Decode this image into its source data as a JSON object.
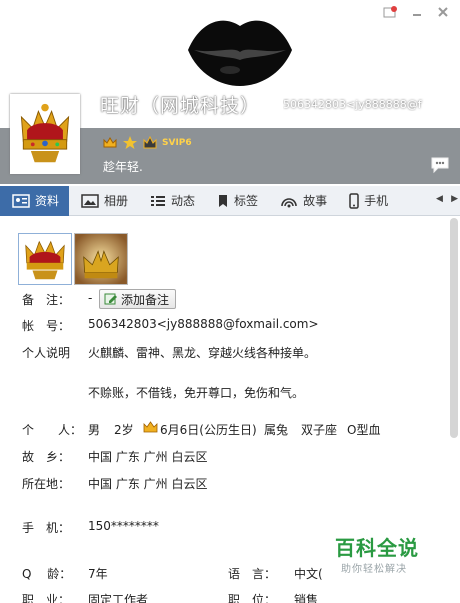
{
  "profile": {
    "name": "旺财（网城科技）",
    "account": "506342803<jy888888@f",
    "signature": "趁年轻.",
    "vip_label": "SVIP6"
  },
  "tabs": [
    {
      "label": "资料",
      "icon": "profile-card-icon",
      "active": true
    },
    {
      "label": "相册",
      "icon": "photo-icon",
      "active": false
    },
    {
      "label": "动态",
      "icon": "feed-list-icon",
      "active": false
    },
    {
      "label": "标签",
      "icon": "tag-icon",
      "active": false
    },
    {
      "label": "故事",
      "icon": "broadcast-icon",
      "active": false
    },
    {
      "label": "手机",
      "icon": "phone-icon",
      "active": false
    }
  ],
  "details": {
    "remark": {
      "label": "备　注：",
      "dash": "-",
      "button": "添加备注"
    },
    "account": {
      "label": "帐　号：",
      "value": "506342803<jy888888@foxmail.com>"
    },
    "bio": {
      "label": "个人说明",
      "line1": "火麒麟、雷神、黑龙、穿越火线各种接单。",
      "line2": "不赊账，不借钱，免开尊口，免伤和气。"
    },
    "personal": {
      "label": "个　　人：",
      "gender": "男",
      "age": "2岁",
      "birthday": "6月6日(公历生日)",
      "zodiac": "属兔",
      "star_sign": "双子座",
      "blood": "O型血"
    },
    "hometown": {
      "label": "故　乡：",
      "value": "中国 广东 广州 白云区"
    },
    "location": {
      "label": "所在地：",
      "value": "中国 广东 广州 白云区"
    },
    "mobile": {
      "label": "手　机：",
      "value": "150********"
    },
    "q_age": {
      "label": "Q　 龄：",
      "value": "7年"
    },
    "language": {
      "label": "语　言：",
      "value": "中文("
    },
    "job": {
      "label": "职　业：",
      "value": "固定工作者"
    },
    "position": {
      "label": "职　位：",
      "value": "销售"
    }
  },
  "watermark": {
    "title": "百科全说",
    "subtitle": "助你轻松解决"
  },
  "colors": {
    "tab_active": "#3d6ca8",
    "header_band": "#8d9296",
    "watermark_green": "#2a9a42"
  }
}
